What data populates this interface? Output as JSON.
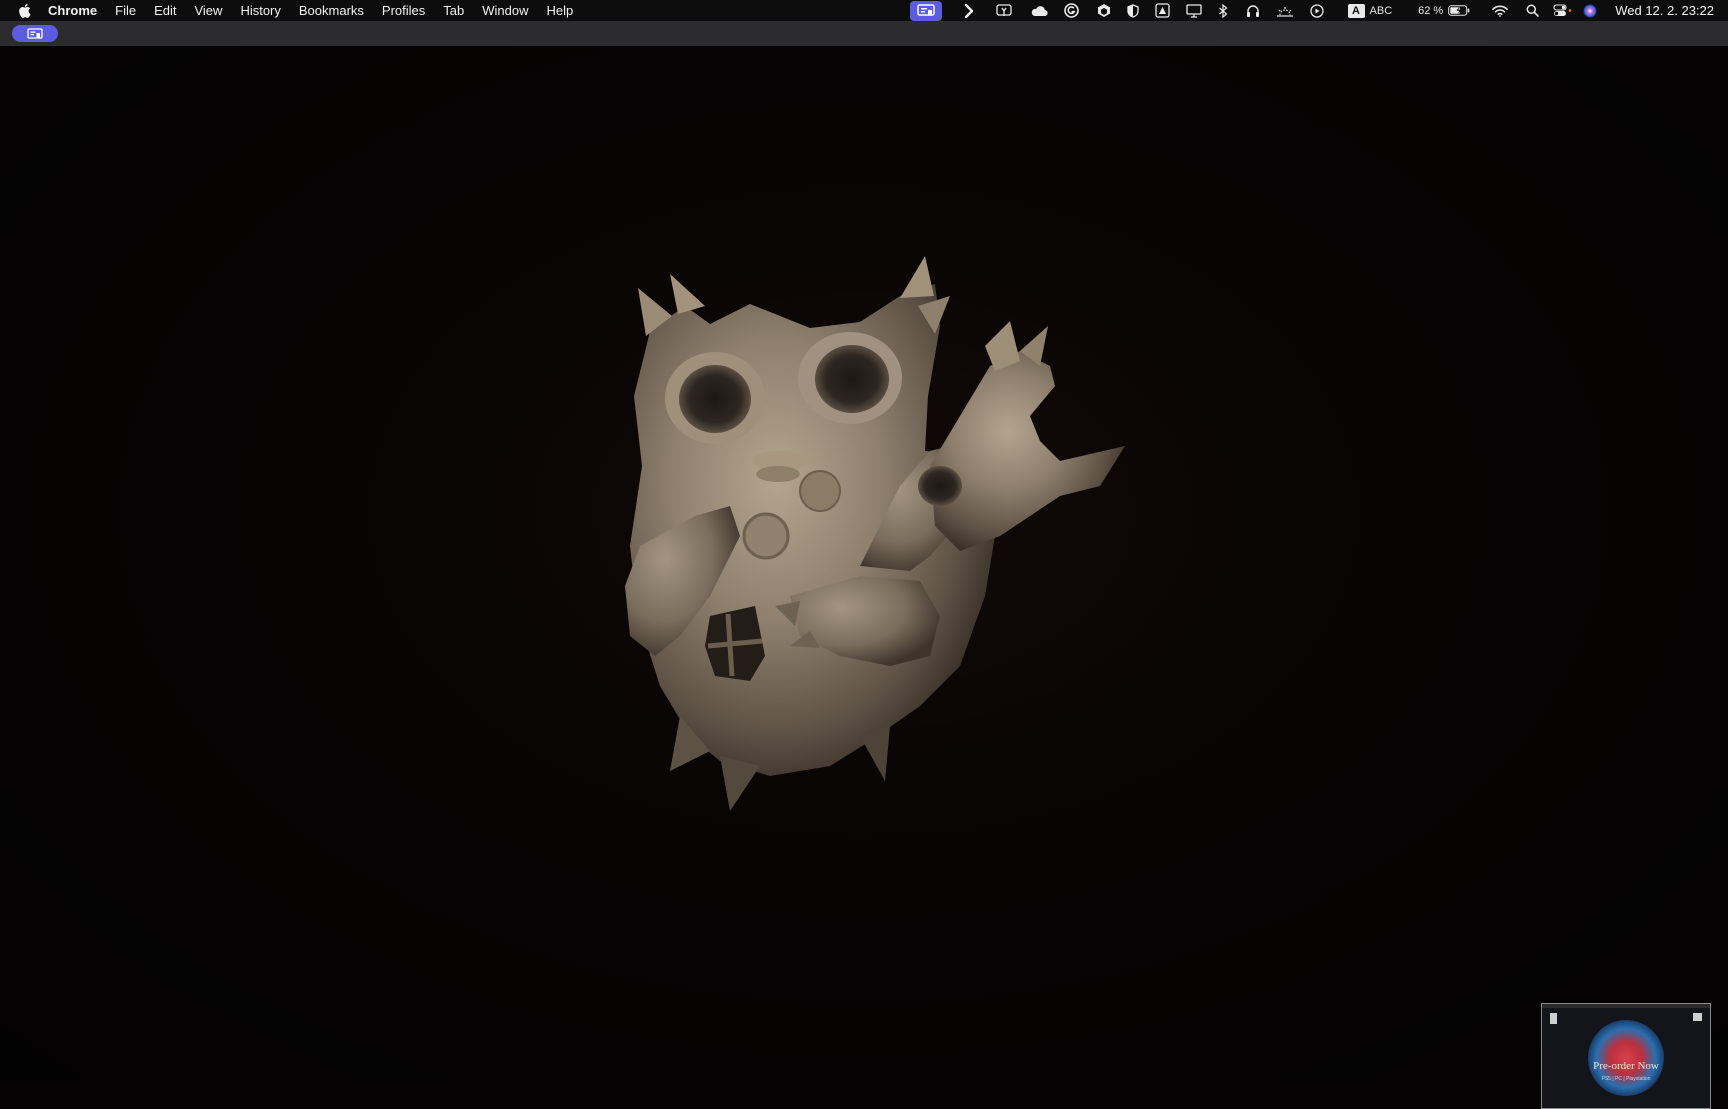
{
  "menubar": {
    "app_name": "Chrome",
    "menus": [
      "File",
      "Edit",
      "View",
      "History",
      "Bookmarks",
      "Profiles",
      "Tab",
      "Window",
      "Help"
    ],
    "status_icons": [
      "screen-share-icon",
      "chevron-right-icon",
      "pen-mic-icon",
      "cloud-icon",
      "grammarly-icon",
      "hexagon-app-icon",
      "shield-icon",
      "triangle-app-icon",
      "display-icon",
      "bluetooth-icon",
      "headphones-icon",
      "weather-icon",
      "play-icon"
    ],
    "input_source_letter": "A",
    "input_source_label": "ABC",
    "battery_percent": "62 %",
    "clock": "Wed 12. 2.  23:22"
  },
  "subbar": {
    "pill_icon": "screen-share-icon"
  },
  "video": {
    "subject": "clay-owl-sculpture"
  },
  "thumbnail": {
    "title": "Pre-order Now",
    "subtitle": "PS5 | PC | Playstation"
  },
  "colors": {
    "accent": "#5b5ce0",
    "menubar_bg": "#0d0d0d",
    "subbar_bg": "#2c2c2e",
    "video_bg": "#050303"
  }
}
